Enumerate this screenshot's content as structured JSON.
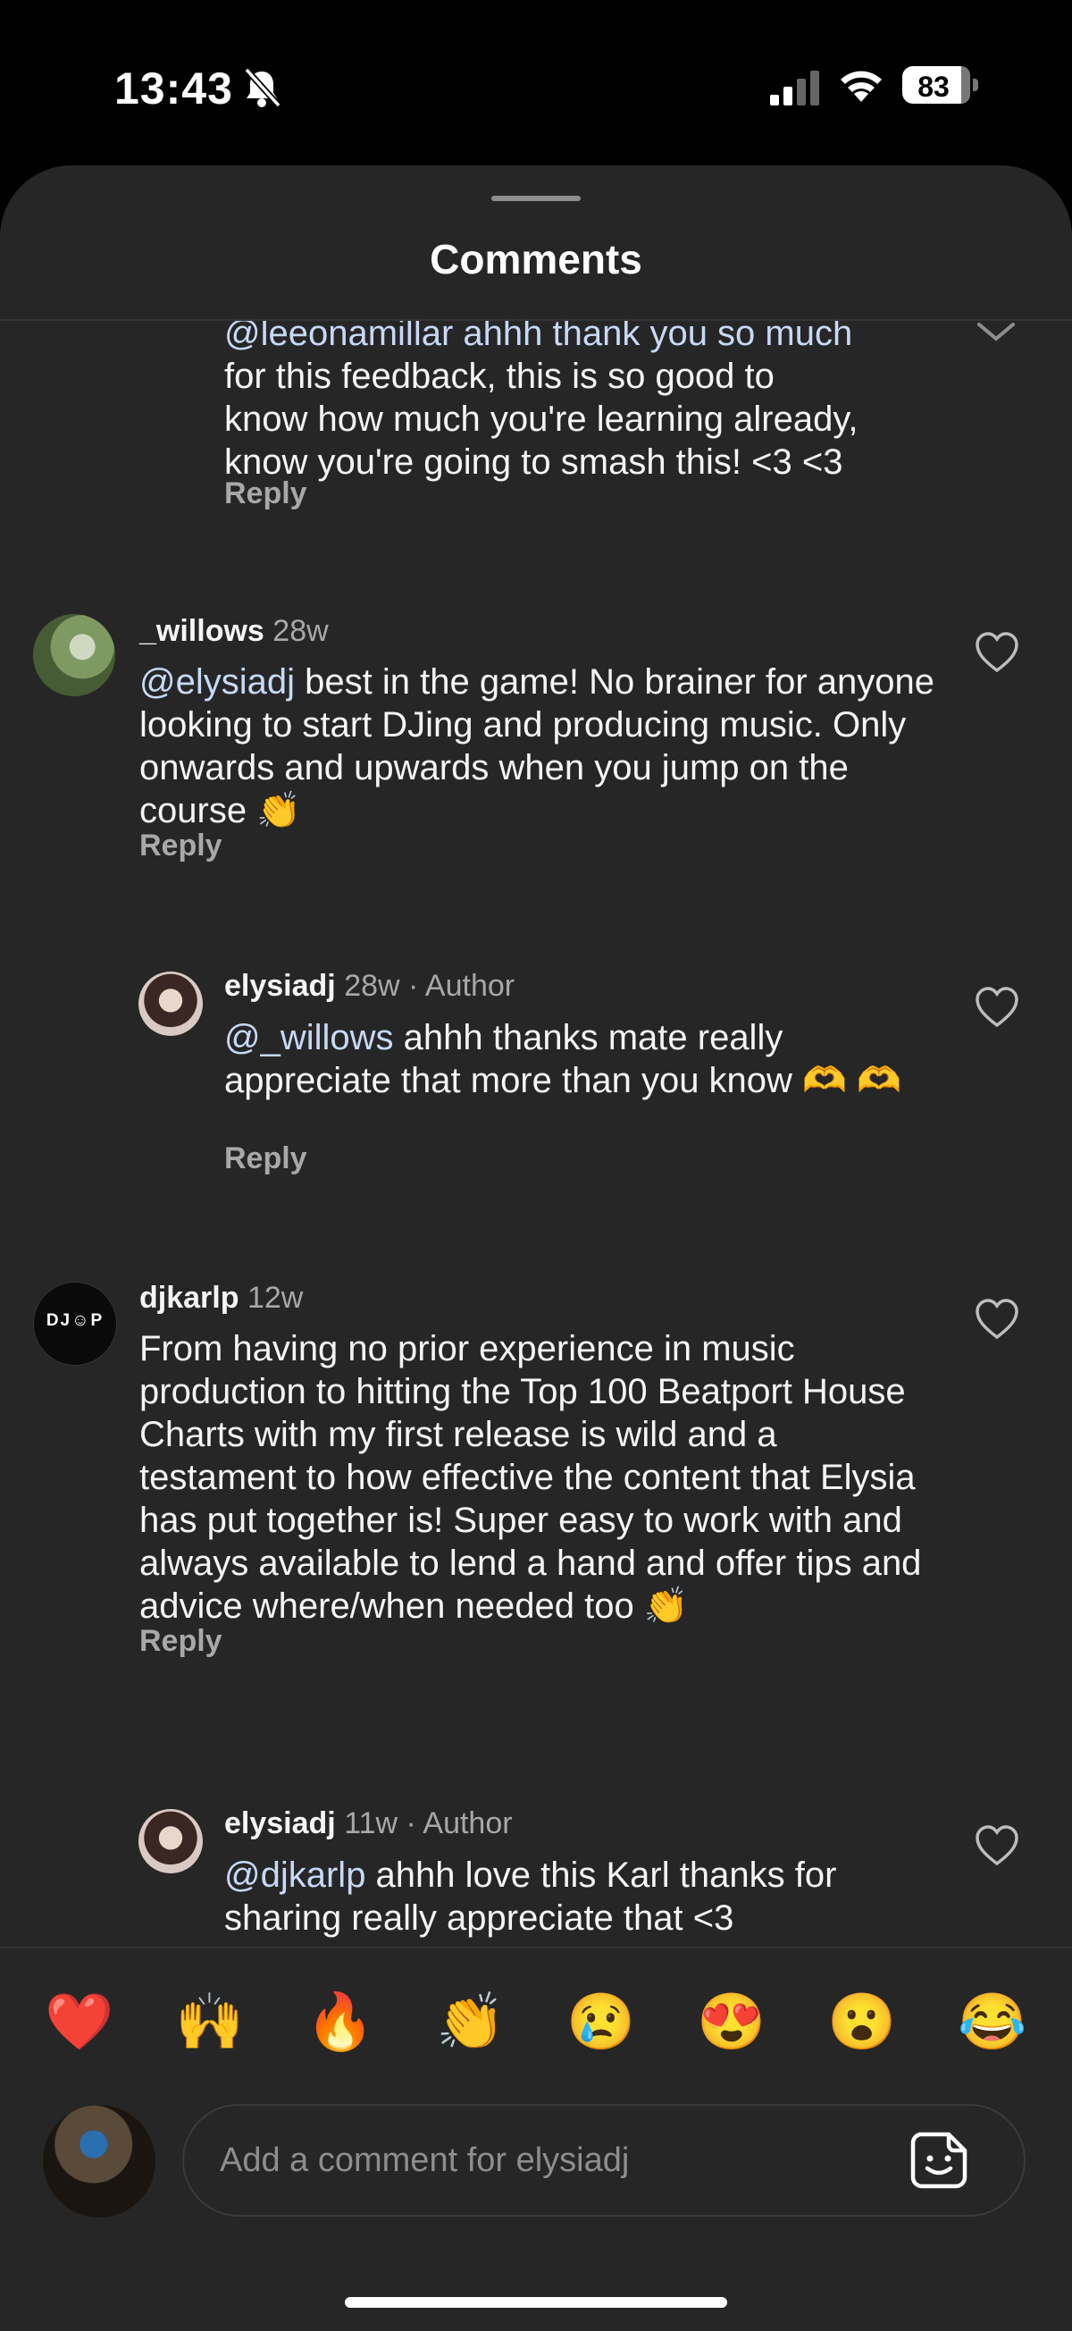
{
  "status_bar": {
    "time": "13:43",
    "battery": "83",
    "icons": [
      "bell-slash-icon",
      "signal-icon",
      "wifi-icon",
      "battery-icon"
    ]
  },
  "sheet": {
    "title": "Comments"
  },
  "comments": [
    {
      "text_lines": [
        "@leeonamillar ahhh thank you so much",
        "for this feedback, this is so good to",
        "know how much you're learning already,",
        "know you're going to smash this! <3 <3"
      ],
      "reply": "Reply"
    },
    {
      "username": "_willows",
      "time": "28w",
      "mention": "@elysiadj",
      "text": " best in the game! No brainer for anyone looking to start DJing and producing music. Only onwards and upwards when you jump on the course 👏",
      "reply": "Reply"
    },
    {
      "username": "elysiadj",
      "time": "28w · Author",
      "mention": "@_willows",
      "text": " ahhh thanks mate really appreciate that more than you know 🫶 🫶",
      "reply": "Reply"
    },
    {
      "username": "djkarlp",
      "avatar_text": "DJ☺P",
      "time": "12w",
      "text": "From having no prior experience in music production to hitting the Top 100 Beatport House Charts with my first release is wild and a testament to how effective the content that Elysia has put together is! Super easy to work with and always available to lend a hand and offer tips and advice where/when needed too 👏",
      "reply": "Reply"
    },
    {
      "username": "elysiadj",
      "time": "11w · Author",
      "mention": "@djkarlp",
      "text": " ahhh love this Karl thanks for sharing really appreciate that <3"
    }
  ],
  "emoji_bar": [
    "❤️",
    "🙌",
    "🔥",
    "👏",
    "😢",
    "😍",
    "😮",
    "😂"
  ],
  "composer": {
    "placeholder": "Add a comment for elysiadj"
  }
}
